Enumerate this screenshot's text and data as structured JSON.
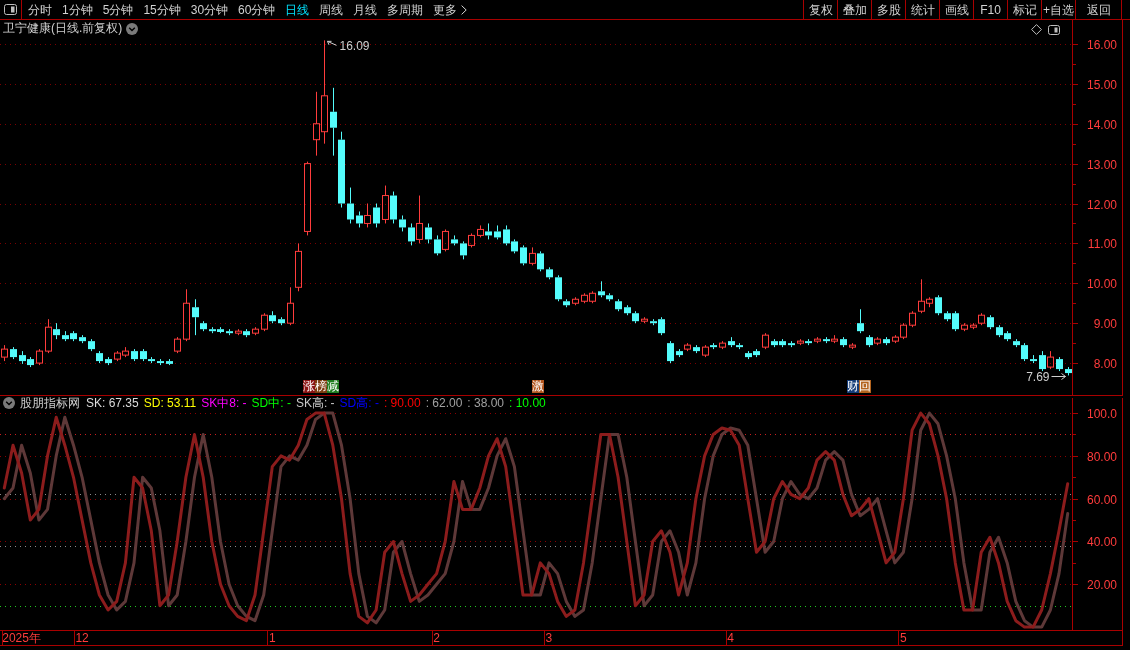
{
  "toolbar": {
    "tabs": [
      {
        "label": "分时",
        "kind": "period",
        "selected": false
      },
      {
        "label": "1分钟",
        "kind": "period",
        "selected": false
      },
      {
        "label": "5分钟",
        "kind": "period",
        "selected": false
      },
      {
        "label": "15分钟",
        "kind": "period",
        "selected": false
      },
      {
        "label": "30分钟",
        "kind": "period",
        "selected": false
      },
      {
        "label": "60分钟",
        "kind": "period",
        "selected": false
      },
      {
        "label": "日线",
        "kind": "period",
        "selected": true
      },
      {
        "label": "周线",
        "kind": "period",
        "selected": false
      },
      {
        "label": "月线",
        "kind": "period",
        "selected": false
      },
      {
        "label": "多周期",
        "kind": "period",
        "selected": false
      },
      {
        "label": "更多",
        "kind": "menu",
        "selected": false
      }
    ],
    "buttons": [
      "复权",
      "叠加",
      "多股",
      "统计",
      "画线",
      "F10",
      "标记",
      "+自选",
      "返回"
    ]
  },
  "price_pane": {
    "title": "卫宁健康(日线.前复权)",
    "event_markers": [
      {
        "items": [
          {
            "text": "涨",
            "color": "#8c1414"
          },
          {
            "text": "榜",
            "color": "#7d3c0f"
          },
          {
            "text": "减",
            "color": "#1e7d1e"
          }
        ]
      },
      {
        "items": [
          {
            "text": "激",
            "color": "#b4561e"
          }
        ]
      },
      {
        "items": [
          {
            "text": "财",
            "color": "#143c78"
          },
          {
            "text": "回",
            "color": "#b4641e"
          }
        ]
      }
    ],
    "chart_data": [
      {
        "type": "candlestick",
        "ylim": [
          7.2,
          16.6
        ],
        "grid": true,
        "yticks": [
          {
            "value": 16,
            "label": "16.00"
          },
          {
            "value": 15,
            "label": "15.00"
          },
          {
            "value": 14,
            "label": "14.00"
          },
          {
            "value": 13,
            "label": "13.00"
          },
          {
            "value": 12,
            "label": "12.00"
          },
          {
            "value": 11,
            "label": "11.00"
          },
          {
            "value": 10,
            "label": "10.00"
          },
          {
            "value": 9,
            "label": "9.00"
          },
          {
            "value": 8,
            "label": "8.00"
          }
        ],
        "annotations": [
          "16.09",
          "7.69"
        ],
        "categories": [
          null,
          null,
          null,
          null,
          null,
          null,
          null,
          null,
          null,
          null,
          null,
          null,
          null,
          null,
          null,
          null,
          null,
          null,
          null,
          null,
          null,
          null,
          null,
          null,
          null,
          null,
          null,
          null,
          null,
          null,
          null,
          null,
          null,
          null,
          null,
          null,
          null,
          null,
          null,
          null,
          null,
          null,
          null,
          null,
          null,
          null,
          null,
          null,
          null,
          null,
          null,
          null,
          null,
          null,
          null,
          null,
          null,
          null,
          null,
          null,
          null,
          null,
          null,
          null,
          null,
          null,
          null,
          null,
          null,
          null,
          null,
          null,
          null,
          null,
          null,
          null,
          null,
          null,
          null,
          null,
          null,
          null,
          null,
          null,
          null,
          null,
          null,
          null,
          null,
          null,
          null,
          null,
          null,
          null,
          null,
          null,
          null,
          null,
          null,
          null,
          null,
          null,
          null,
          null,
          null,
          null,
          null,
          null,
          null,
          null,
          null,
          null,
          null,
          null,
          null,
          null,
          null,
          null,
          null,
          null,
          null,
          null,
          null,
          null
        ],
        "ohlc": [
          [
            8.15,
            8.45,
            8.05,
            8.35
          ],
          [
            8.35,
            8.4,
            8.1,
            8.15
          ],
          [
            8.2,
            8.3,
            7.98,
            8.05
          ],
          [
            8.1,
            8.15,
            7.9,
            7.95
          ],
          [
            8.0,
            8.35,
            7.95,
            8.3
          ],
          [
            8.3,
            9.1,
            8.25,
            8.9
          ],
          [
            8.85,
            9.0,
            8.6,
            8.7
          ],
          [
            8.7,
            8.8,
            8.55,
            8.6
          ],
          [
            8.75,
            8.8,
            8.55,
            8.6
          ],
          [
            8.65,
            8.7,
            8.5,
            8.55
          ],
          [
            8.55,
            8.6,
            8.3,
            8.35
          ],
          [
            8.25,
            8.3,
            8.0,
            8.05
          ],
          [
            8.1,
            8.15,
            7.95,
            8.0
          ],
          [
            8.1,
            8.3,
            8.05,
            8.25
          ],
          [
            8.2,
            8.4,
            8.15,
            8.3
          ],
          [
            8.3,
            8.35,
            8.05,
            8.1
          ],
          [
            8.3,
            8.35,
            8.05,
            8.1
          ],
          [
            8.1,
            8.15,
            8.0,
            8.05
          ],
          [
            8.05,
            8.1,
            7.95,
            8.0
          ],
          [
            8.05,
            8.1,
            7.95,
            7.98
          ],
          [
            8.3,
            8.65,
            8.25,
            8.6
          ],
          [
            8.6,
            9.85,
            8.55,
            9.5
          ],
          [
            9.4,
            9.6,
            8.7,
            9.15
          ],
          [
            9.0,
            9.05,
            8.8,
            8.85
          ],
          [
            8.85,
            8.9,
            8.75,
            8.8
          ],
          [
            8.85,
            8.9,
            8.75,
            8.78
          ],
          [
            8.8,
            8.85,
            8.7,
            8.75
          ],
          [
            8.75,
            8.85,
            8.7,
            8.8
          ],
          [
            8.8,
            8.85,
            8.65,
            8.7
          ],
          [
            8.75,
            8.9,
            8.7,
            8.85
          ],
          [
            8.85,
            9.25,
            8.8,
            9.2
          ],
          [
            9.2,
            9.3,
            9.0,
            9.05
          ],
          [
            9.1,
            9.15,
            8.95,
            9.0
          ],
          [
            9.0,
            9.9,
            8.95,
            9.5
          ],
          [
            9.9,
            11.0,
            9.8,
            10.8
          ],
          [
            11.3,
            13.05,
            11.2,
            13.0
          ],
          [
            13.6,
            14.8,
            13.2,
            14.0
          ],
          [
            13.8,
            16.09,
            13.5,
            14.7
          ],
          [
            14.3,
            14.9,
            13.2,
            13.9
          ],
          [
            13.6,
            13.8,
            11.9,
            12.0
          ],
          [
            12.0,
            12.4,
            11.5,
            11.6
          ],
          [
            11.7,
            11.8,
            11.4,
            11.5
          ],
          [
            11.5,
            12.0,
            11.4,
            11.7
          ],
          [
            11.9,
            12.0,
            11.4,
            11.5
          ],
          [
            11.6,
            12.45,
            11.5,
            12.2
          ],
          [
            12.2,
            12.3,
            11.5,
            11.6
          ],
          [
            11.6,
            11.7,
            11.3,
            11.4
          ],
          [
            11.4,
            11.5,
            10.95,
            11.05
          ],
          [
            11.1,
            12.2,
            11.0,
            11.5
          ],
          [
            11.4,
            11.5,
            11.0,
            11.1
          ],
          [
            11.1,
            11.2,
            10.7,
            10.75
          ],
          [
            10.85,
            11.35,
            10.8,
            11.3
          ],
          [
            11.1,
            11.2,
            10.95,
            11.0
          ],
          [
            11.0,
            11.05,
            10.6,
            10.7
          ],
          [
            10.95,
            11.25,
            10.9,
            11.2
          ],
          [
            11.2,
            11.45,
            11.15,
            11.35
          ],
          [
            11.3,
            11.5,
            11.1,
            11.2
          ],
          [
            11.3,
            11.45,
            11.1,
            11.15
          ],
          [
            11.35,
            11.45,
            10.95,
            11.0
          ],
          [
            11.05,
            11.1,
            10.75,
            10.8
          ],
          [
            10.9,
            10.95,
            10.45,
            10.5
          ],
          [
            10.5,
            10.9,
            10.45,
            10.75
          ],
          [
            10.75,
            10.8,
            10.3,
            10.35
          ],
          [
            10.35,
            10.4,
            10.1,
            10.15
          ],
          [
            10.15,
            10.2,
            9.55,
            9.6
          ],
          [
            9.55,
            9.6,
            9.4,
            9.45
          ],
          [
            9.5,
            9.65,
            9.45,
            9.6
          ],
          [
            9.55,
            9.75,
            9.5,
            9.7
          ],
          [
            9.55,
            9.8,
            9.5,
            9.75
          ],
          [
            9.8,
            10.05,
            9.65,
            9.7
          ],
          [
            9.7,
            9.75,
            9.55,
            9.6
          ],
          [
            9.55,
            9.6,
            9.3,
            9.35
          ],
          [
            9.4,
            9.45,
            9.2,
            9.25
          ],
          [
            9.25,
            9.3,
            9.0,
            9.05
          ],
          [
            9.05,
            9.15,
            9.0,
            9.1
          ],
          [
            9.05,
            9.1,
            8.95,
            9.0
          ],
          [
            9.1,
            9.15,
            8.7,
            8.75
          ],
          [
            8.5,
            8.55,
            8.0,
            8.05
          ],
          [
            8.3,
            8.35,
            8.15,
            8.2
          ],
          [
            8.35,
            8.5,
            8.3,
            8.45
          ],
          [
            8.4,
            8.45,
            8.25,
            8.3
          ],
          [
            8.2,
            8.45,
            8.15,
            8.4
          ],
          [
            8.45,
            8.5,
            8.35,
            8.4
          ],
          [
            8.4,
            8.55,
            8.35,
            8.5
          ],
          [
            8.55,
            8.65,
            8.4,
            8.45
          ],
          [
            8.45,
            8.5,
            8.35,
            8.4
          ],
          [
            8.25,
            8.3,
            8.1,
            8.15
          ],
          [
            8.3,
            8.35,
            8.15,
            8.2
          ],
          [
            8.4,
            8.75,
            8.35,
            8.7
          ],
          [
            8.55,
            8.6,
            8.4,
            8.45
          ],
          [
            8.55,
            8.6,
            8.4,
            8.45
          ],
          [
            8.5,
            8.55,
            8.4,
            8.45
          ],
          [
            8.5,
            8.6,
            8.45,
            8.55
          ],
          [
            8.55,
            8.6,
            8.45,
            8.5
          ],
          [
            8.55,
            8.65,
            8.5,
            8.6
          ],
          [
            8.6,
            8.65,
            8.5,
            8.55
          ],
          [
            8.55,
            8.7,
            8.5,
            8.6
          ],
          [
            8.6,
            8.65,
            8.4,
            8.45
          ],
          [
            8.4,
            8.5,
            8.35,
            8.45
          ],
          [
            9.0,
            9.35,
            8.75,
            8.8
          ],
          [
            8.65,
            8.7,
            8.4,
            8.45
          ],
          [
            8.5,
            8.65,
            8.45,
            8.6
          ],
          [
            8.6,
            8.65,
            8.45,
            8.5
          ],
          [
            8.55,
            8.7,
            8.5,
            8.65
          ],
          [
            8.65,
            9.0,
            8.6,
            8.95
          ],
          [
            8.95,
            9.3,
            8.9,
            9.25
          ],
          [
            9.3,
            10.1,
            9.25,
            9.55
          ],
          [
            9.5,
            9.65,
            9.4,
            9.6
          ],
          [
            9.65,
            9.7,
            9.2,
            9.25
          ],
          [
            9.25,
            9.3,
            9.05,
            9.1
          ],
          [
            9.25,
            9.3,
            8.8,
            8.85
          ],
          [
            8.85,
            9.0,
            8.8,
            8.95
          ],
          [
            8.9,
            9.0,
            8.85,
            8.95
          ],
          [
            9.0,
            9.25,
            8.95,
            9.2
          ],
          [
            9.15,
            9.2,
            8.85,
            8.9
          ],
          [
            8.9,
            8.95,
            8.65,
            8.7
          ],
          [
            8.75,
            8.8,
            8.55,
            8.6
          ],
          [
            8.55,
            8.6,
            8.4,
            8.45
          ],
          [
            8.45,
            8.5,
            8.05,
            8.1
          ],
          [
            8.1,
            8.2,
            8.0,
            8.05
          ],
          [
            8.2,
            8.3,
            7.8,
            7.85
          ],
          [
            7.9,
            8.3,
            7.85,
            8.15
          ],
          [
            8.1,
            8.15,
            7.8,
            7.85
          ],
          [
            7.85,
            7.9,
            7.69,
            7.75
          ]
        ]
      }
    ]
  },
  "indicator_pane": {
    "title": "股朋指标网",
    "legend": [
      {
        "text": "SK: 67.35",
        "color": "#dcdcdc"
      },
      {
        "text": "SD: 53.11",
        "color": "#ffff00"
      },
      {
        "text": "SK中8: -",
        "color": "#ff00ff"
      },
      {
        "text": "SD中: -",
        "color": "#00ff00"
      },
      {
        "text": "SK高: -",
        "color": "#c8c8c8"
      },
      {
        "text": "SD高: -",
        "color": "#0000ff"
      },
      {
        "text": ": 90.00",
        "color": "#ff0000"
      },
      {
        "text": ": 62.00",
        "color": "#a0a0a0"
      },
      {
        "text": ": 38.00",
        "color": "#a0a0a0"
      },
      {
        "text": ": 10.00",
        "color": "#00ff00"
      }
    ],
    "chart_data": [
      {
        "type": "line",
        "ylim": [
          -1.6,
          108.2
        ],
        "grid": true,
        "yticks": [
          {
            "value": 100,
            "label": "100.0"
          },
          {
            "value": 80,
            "label": "80.00"
          },
          {
            "value": 60,
            "label": "60.00"
          },
          {
            "value": 40,
            "label": "40.00"
          },
          {
            "value": 20,
            "label": "20.00"
          }
        ],
        "ref_lines": [
          {
            "axis": "y",
            "value": 90,
            "color": "#c81e1e",
            "line_style": "dotted"
          },
          {
            "axis": "y",
            "value": 62,
            "color": "#8c8c8c",
            "line_style": "dotted"
          },
          {
            "axis": "y",
            "value": 38,
            "color": "#8c8c8c",
            "line_style": "dotted"
          },
          {
            "axis": "y",
            "value": 10,
            "color": "#1ec81e",
            "line_style": "dotted"
          }
        ],
        "categories": [
          null,
          null,
          "2025年",
          null,
          null,
          null,
          null,
          null,
          null,
          "12",
          null,
          null,
          null,
          null,
          null,
          null,
          null,
          null,
          null,
          null,
          null,
          null,
          null,
          null,
          null,
          null,
          null,
          null,
          null,
          null,
          null,
          "1",
          null,
          null,
          null,
          null,
          null,
          null,
          null,
          null,
          null,
          null,
          null,
          null,
          null,
          null,
          null,
          null,
          null,
          null,
          "2",
          null,
          null,
          null,
          null,
          null,
          null,
          null,
          null,
          null,
          null,
          null,
          null,
          "3",
          null,
          null,
          null,
          null,
          null,
          null,
          null,
          null,
          null,
          null,
          null,
          null,
          null,
          null,
          null,
          null,
          null,
          null,
          null,
          null,
          "4",
          null,
          null,
          null,
          null,
          null,
          null,
          null,
          null,
          null,
          null,
          null,
          null,
          null,
          null,
          null,
          null,
          null,
          null,
          null,
          "5",
          null,
          null,
          null,
          null,
          null,
          null,
          null,
          null,
          null,
          null,
          null,
          null,
          null,
          null,
          null,
          null,
          null,
          null,
          null
        ],
        "series": [
          {
            "color": "#8c1c1c",
            "values": [
              65,
              85,
              72,
              50,
              55,
              80,
              98,
              85,
              70,
              50,
              30,
              15,
              8,
              12,
              30,
              70,
              65,
              45,
              10,
              15,
              40,
              70,
              90,
              70,
              40,
              20,
              10,
              5,
              3,
              15,
              45,
              75,
              80,
              78,
              85,
              97,
              100,
              100,
              85,
              60,
              25,
              5,
              2,
              8,
              35,
              40,
              25,
              12,
              15,
              20,
              25,
              40,
              68,
              55,
              55,
              65,
              80,
              88,
              75,
              45,
              15,
              15,
              30,
              25,
              12,
              5,
              8,
              30,
              60,
              90,
              90,
              70,
              40,
              10,
              15,
              40,
              45,
              35,
              15,
              30,
              60,
              80,
              90,
              93,
              92,
              85,
              60,
              35,
              40,
              60,
              68,
              62,
              60,
              65,
              78,
              82,
              78,
              62,
              52,
              55,
              60,
              45,
              30,
              35,
              60,
              92,
              100,
              95,
              80,
              60,
              30,
              8,
              8,
              35,
              42,
              30,
              12,
              3,
              0,
              0,
              8,
              25,
              45,
              67
            ]
          },
          {
            "color": "#5e3838",
            "values": [
              60,
              65,
              85,
              72,
              50,
              55,
              80,
              98,
              85,
              70,
              50,
              30,
              15,
              8,
              12,
              30,
              70,
              65,
              45,
              10,
              15,
              40,
              70,
              90,
              70,
              40,
              20,
              10,
              5,
              3,
              15,
              45,
              75,
              80,
              78,
              85,
              97,
              100,
              100,
              85,
              60,
              25,
              5,
              2,
              8,
              35,
              40,
              25,
              12,
              15,
              20,
              25,
              40,
              68,
              55,
              55,
              65,
              80,
              88,
              75,
              45,
              15,
              15,
              30,
              25,
              12,
              5,
              8,
              30,
              60,
              90,
              90,
              70,
              40,
              10,
              15,
              40,
              45,
              35,
              15,
              30,
              60,
              80,
              90,
              93,
              92,
              85,
              60,
              35,
              40,
              60,
              68,
              62,
              60,
              65,
              78,
              82,
              78,
              62,
              52,
              55,
              60,
              45,
              30,
              35,
              60,
              92,
              100,
              95,
              80,
              60,
              30,
              8,
              8,
              35,
              42,
              30,
              12,
              3,
              0,
              0,
              8,
              25,
              53
            ]
          }
        ]
      }
    ]
  }
}
